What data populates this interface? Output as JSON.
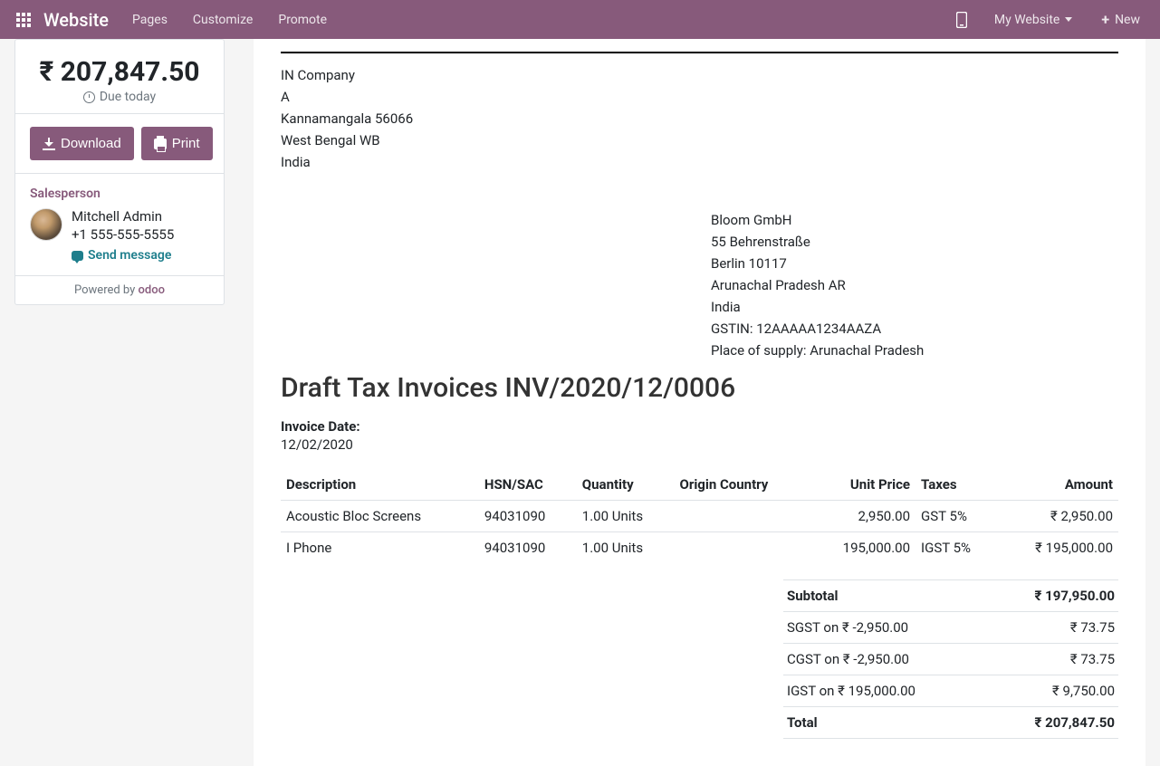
{
  "navbar": {
    "brand": "Website",
    "links": {
      "pages": "Pages",
      "customize": "Customize",
      "promote": "Promote"
    },
    "my_website": "My Website",
    "new": "New"
  },
  "sidebar": {
    "amount": "₹ 207,847.50",
    "due": "Due today",
    "download": "Download",
    "print": "Print",
    "salesperson_label": "Salesperson",
    "salesperson_name": "Mitchell Admin",
    "salesperson_phone": "+1 555-555-5555",
    "send_message": "Send message",
    "powered_by": "Powered by ",
    "powered_brand": "odoo"
  },
  "company": {
    "name": "IN Company",
    "line1": "A",
    "line2": "Kannamangala 56066",
    "line3": "West Bengal WB",
    "line4": "India"
  },
  "customer": {
    "name": "Bloom GmbH",
    "line1": "55 Behrenstraße",
    "line2": "Berlin 10117",
    "line3": "Arunachal Pradesh AR",
    "line4": "India",
    "gstin": "GSTIN: 12AAAAA1234AAZA",
    "pos": "Place of supply: Arunachal Pradesh"
  },
  "doc": {
    "title": "Draft Tax Invoices INV/2020/12/0006",
    "date_label": "Invoice Date:",
    "date_value": "12/02/2020"
  },
  "headers": {
    "description": "Description",
    "hsn": "HSN/SAC",
    "qty": "Quantity",
    "origin": "Origin Country",
    "price": "Unit Price",
    "taxes": "Taxes",
    "amount": "Amount"
  },
  "lines": [
    {
      "desc": "Acoustic Bloc Screens",
      "hsn": "94031090",
      "qty": "1.00 Units",
      "origin": "",
      "price": "2,950.00",
      "taxes": "GST 5%",
      "amount": "₹ 2,950.00"
    },
    {
      "desc": "I Phone",
      "hsn": "94031090",
      "qty": "1.00 Units",
      "origin": "",
      "price": "195,000.00",
      "taxes": "IGST 5%",
      "amount": "₹ 195,000.00"
    }
  ],
  "totals": [
    {
      "label": "Subtotal",
      "value": "₹ 197,950.00",
      "bold": true
    },
    {
      "label": "SGST on ₹ -2,950.00",
      "value": "₹ 73.75",
      "bold": false
    },
    {
      "label": "CGST on ₹ -2,950.00",
      "value": "₹ 73.75",
      "bold": false
    },
    {
      "label": "IGST on ₹ 195,000.00",
      "value": "₹ 9,750.00",
      "bold": false
    },
    {
      "label": "Total",
      "value": "₹ 207,847.50",
      "bold": true
    }
  ]
}
